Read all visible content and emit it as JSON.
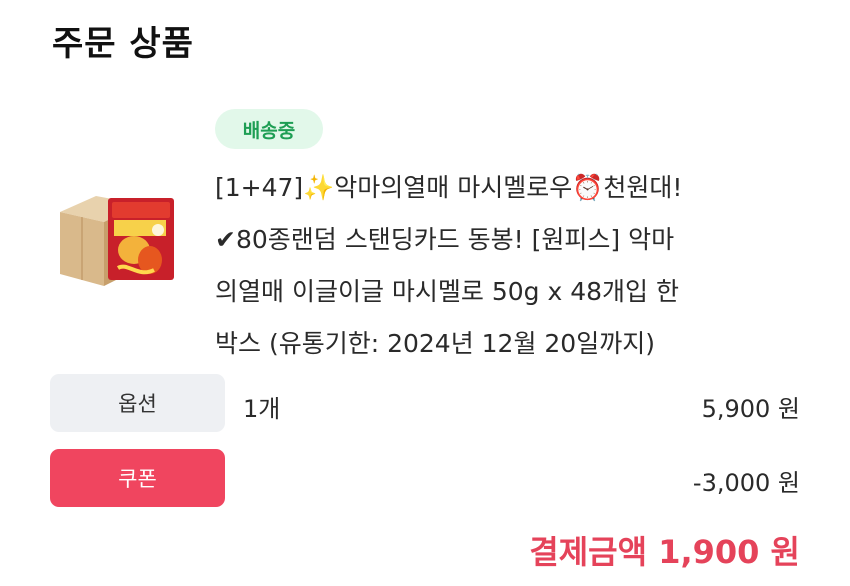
{
  "section_title": "주문 상품",
  "product": {
    "status": "배송중",
    "name_lines": [
      "[1+47]✨악마의열매 마시멜로우⏰천원대!",
      "✔80종랜덤 스탠딩카드 동봉! [원피스] 악마",
      "의열매 이글이글 마시멜로 50g x 48개입 한",
      "박스 (유통기한: 2024년 12월 20일까지)"
    ],
    "thumbnail_icon": "product-box-image"
  },
  "option": {
    "label": "옵션",
    "quantity": "1개",
    "price": "5,900 원"
  },
  "coupon": {
    "label": "쿠폰",
    "discount": "-3,000 원"
  },
  "total": "결제금액 1,900 원",
  "colors": {
    "badge_bg": "#e2f8ea",
    "badge_text": "#1e9e54",
    "coupon_bg": "#f0455f",
    "total_text": "#e5435a"
  }
}
